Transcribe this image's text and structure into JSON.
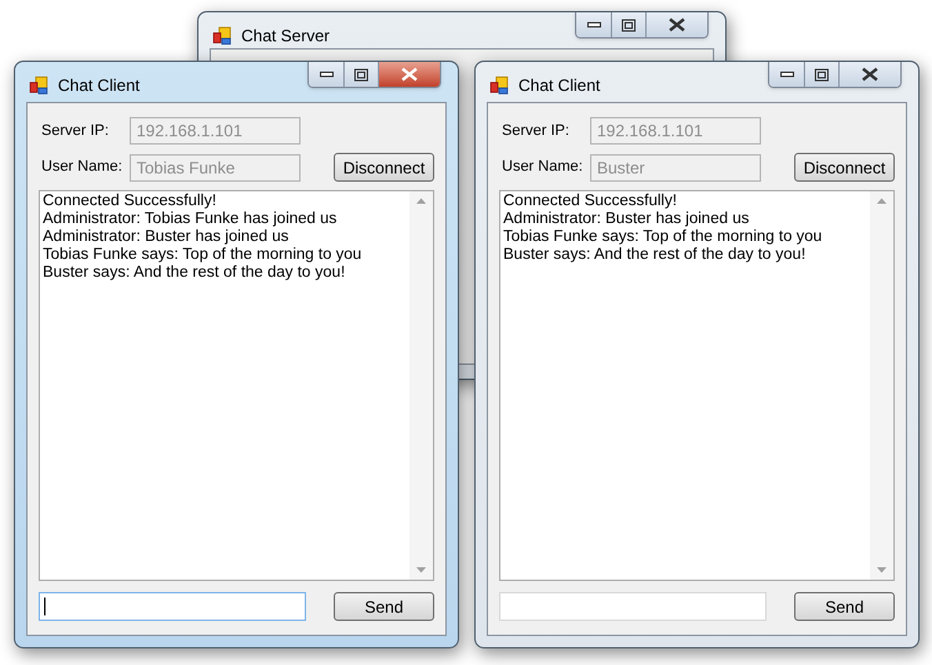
{
  "server_window": {
    "title": "Chat Server",
    "active": false
  },
  "client_windows": [
    {
      "title": "Chat Client",
      "active": true,
      "server_ip_label": "Server IP:",
      "server_ip": "192.168.1.101",
      "user_name_label": "User Name:",
      "user_name": "Tobias Funke",
      "disconnect_button": "Disconnect",
      "messages": [
        "Connected Successfully!",
        "Administrator: Tobias Funke has joined us",
        "Administrator: Buster has joined us",
        "Tobias Funke says: Top of the morning to you",
        "Buster says: And the rest of the day to you!"
      ],
      "input_focused": true,
      "send_button": "Send"
    },
    {
      "title": "Chat Client",
      "active": false,
      "server_ip_label": "Server IP:",
      "server_ip": "192.168.1.101",
      "user_name_label": "User Name:",
      "user_name": "Buster",
      "disconnect_button": "Disconnect",
      "messages": [
        "Connected Successfully!",
        "Administrator: Buster has joined us",
        "Tobias Funke says: Top of the morning to you",
        "Buster says: And the rest of the day to you!"
      ],
      "input_focused": false,
      "send_button": "Send"
    }
  ]
}
